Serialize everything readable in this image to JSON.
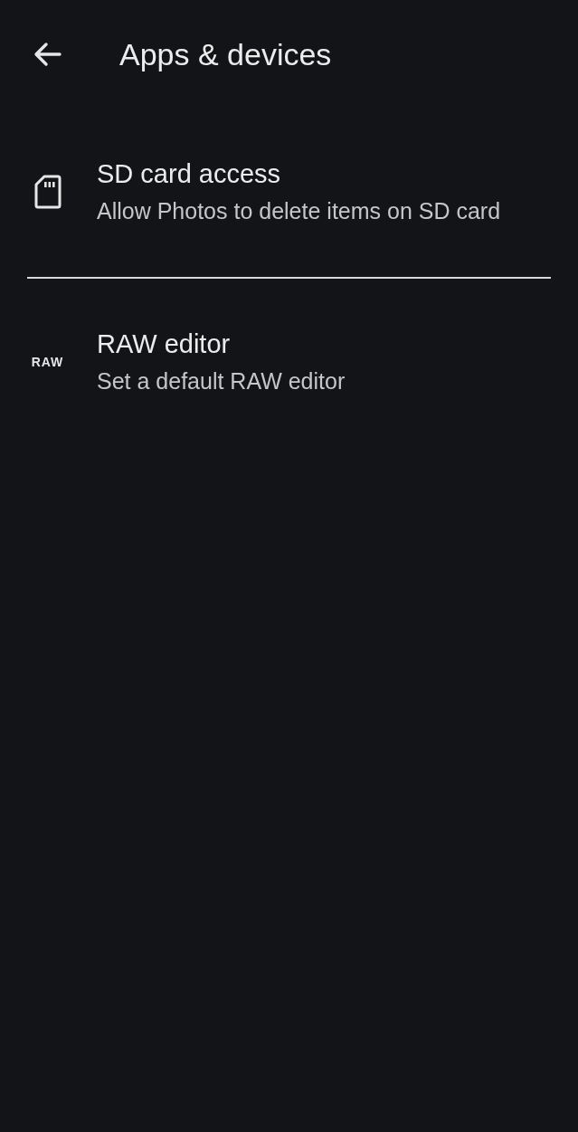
{
  "header": {
    "title": "Apps & devices"
  },
  "items": [
    {
      "kind": "sd-card",
      "title": "SD card access",
      "subtitle": "Allow Photos to delete items on SD card"
    },
    {
      "kind": "text-icon",
      "icon_text": "RAW",
      "title": "RAW editor",
      "subtitle": "Set a default RAW editor"
    }
  ]
}
